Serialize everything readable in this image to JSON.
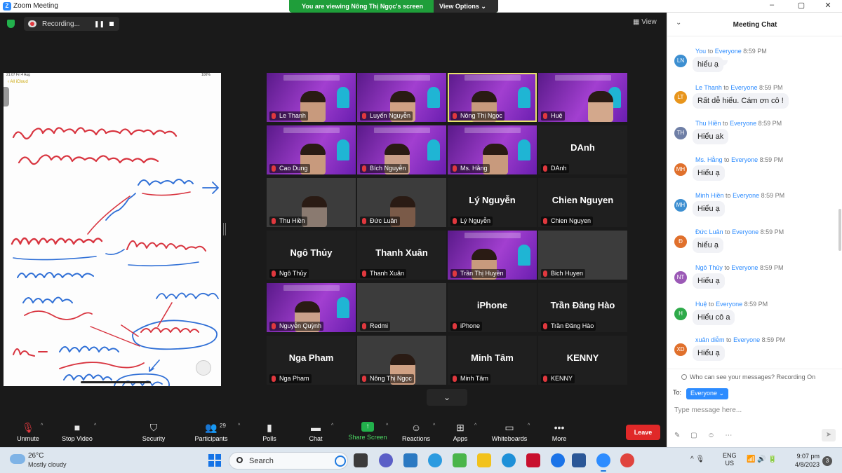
{
  "window": {
    "title": "Zoom Meeting",
    "viewing_banner": "You are viewing Nông Thị Ngọc's screen",
    "view_options": "View Options ⌄",
    "minimize": "–",
    "maximize": "▢",
    "close": "✕"
  },
  "meeting": {
    "recording_label": "Recording...",
    "pause_glyph": "❚❚",
    "view_label": "View",
    "view_glyph": "▦",
    "expand_glyph": "⌄"
  },
  "shared_screen": {
    "status_time": "21:07 Fri 4 Aug",
    "status_right": "100%",
    "notes_back": "‹ All iCloud"
  },
  "participants": [
    {
      "name": "Le Thanh",
      "display": ""
    },
    {
      "name": "Luyến Nguyễn",
      "display": ""
    },
    {
      "name": "Nông Thị Ngọc",
      "display": ""
    },
    {
      "name": "Huệ",
      "display": ""
    },
    {
      "name": "Cao Dung",
      "display": ""
    },
    {
      "name": "Bích Nguyễn",
      "display": ""
    },
    {
      "name": "Ms. Hằng",
      "display": ""
    },
    {
      "name": "DAnh",
      "display": "DAnh"
    },
    {
      "name": "Thu Hiền",
      "display": ""
    },
    {
      "name": "Đức Luân",
      "display": ""
    },
    {
      "name": "Lý Nguyễn",
      "display": "Lý Nguyễn"
    },
    {
      "name": "Chien Nguyen",
      "display": "Chien Nguyen"
    },
    {
      "name": "Ngô Thủy",
      "display": "Ngô Thủy"
    },
    {
      "name": "Thanh Xuân",
      "display": "Thanh Xuân"
    },
    {
      "name": "Trần Thị Huyền",
      "display": ""
    },
    {
      "name": "Bich Huyen",
      "display": ""
    },
    {
      "name": "Nguyễn Quỳnh",
      "display": ""
    },
    {
      "name": "Redmi",
      "display": ""
    },
    {
      "name": "iPhone",
      "display": "iPhone"
    },
    {
      "name": "Trần Đăng Hào",
      "display": "Trần Đăng Hào"
    },
    {
      "name": "Nga Pham",
      "display": "Nga Pham"
    },
    {
      "name": "Nông Thị Ngọc",
      "display": ""
    },
    {
      "name": "Minh Tâm",
      "display": "Minh Tâm"
    },
    {
      "name": "KENNY",
      "display": "KENNY"
    }
  ],
  "toolbar": {
    "unmute": "Unmute",
    "stop_video": "Stop Video",
    "security": "Security",
    "participants": "Participants",
    "participants_count": "29",
    "polls": "Polls",
    "chat": "Chat",
    "share_screen": "Share Screen",
    "reactions": "Reactions",
    "apps": "Apps",
    "whiteboards": "Whiteboards",
    "more": "More",
    "leave": "Leave",
    "caret": "^",
    "more_glyph": "•••"
  },
  "chat": {
    "title": "Meeting Chat",
    "collapse_glyph": "⌄",
    "to_word": "to",
    "everyone_word": "Everyone",
    "messages": [
      {
        "initials": "LN",
        "color": "#3d8fd1",
        "sender": "You",
        "time": "8:59 PM",
        "text": "hiểu ạ"
      },
      {
        "initials": "LT",
        "color": "#e8951c",
        "sender": "Le Thanh",
        "time": "8:59 PM",
        "text": "Rất dễ hiểu. Cám ơn cô !"
      },
      {
        "initials": "TH",
        "color": "#6f7fa6",
        "sender": "Thu Hiền",
        "time": "8:59 PM",
        "text": "Hiểu ak"
      },
      {
        "initials": "MH",
        "color": "#e0702c",
        "sender": "Ms. Hằng",
        "time": "8:59 PM",
        "text": "Hiểu ạ"
      },
      {
        "initials": "MH",
        "color": "#3d8fd1",
        "sender": "Minh Hiền",
        "time": "8:59 PM",
        "text": "Hiểu ạ"
      },
      {
        "initials": "Đ",
        "color": "#e0702c",
        "sender": "Đức Luân",
        "time": "8:59 PM",
        "text": "hiểu ạ"
      },
      {
        "initials": "NT",
        "color": "#9b59b6",
        "sender": "Ngô Thủy",
        "time": "8:59 PM",
        "text": "Hiểu ạ"
      },
      {
        "initials": "H",
        "color": "#2eaa4a",
        "sender": "Huệ",
        "time": "8:59 PM",
        "text": "Hiểu cô a"
      },
      {
        "initials": "XD",
        "color": "#e0702c",
        "sender": "xuân diễm",
        "time": "8:59 PM",
        "text": "Hiểu ạ"
      }
    ],
    "who_can_see": "Who can see your messages? Recording On",
    "to_label": "To:",
    "recipient": "Everyone ⌄",
    "input_placeholder": "Type message here...",
    "tools": "✎ ▢ ☺ ⋯",
    "send_glyph": "➤"
  },
  "taskbar": {
    "temperature": "26°C",
    "weather": "Mostly cloudy",
    "search_label": "Search",
    "lang_line1": "ENG",
    "lang_line2": "US",
    "time": "9:07 pm",
    "date": "4/8/2023",
    "notification_count": "3",
    "tray_glyphs": "^   🎙",
    "net_glyphs": "📶 🔊 🔋"
  }
}
